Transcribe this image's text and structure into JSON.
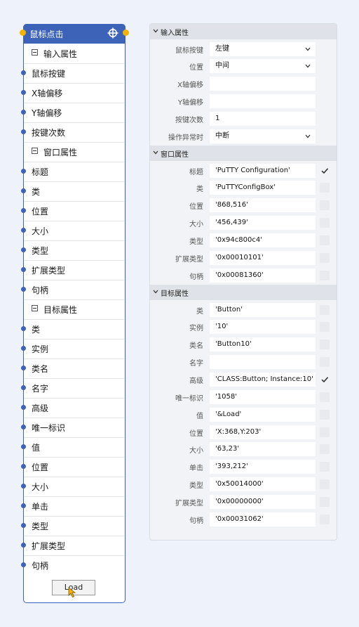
{
  "node": {
    "title": "鼠标点击",
    "load_button": "Load",
    "rows": [
      {
        "type": "group",
        "label": "输入属性"
      },
      {
        "type": "item",
        "label": "鼠标按键"
      },
      {
        "type": "item",
        "label": "X轴偏移"
      },
      {
        "type": "item",
        "label": "Y轴偏移"
      },
      {
        "type": "item",
        "label": "按键次数"
      },
      {
        "type": "group",
        "label": "窗口属性"
      },
      {
        "type": "item",
        "label": "标题"
      },
      {
        "type": "item",
        "label": "类"
      },
      {
        "type": "item",
        "label": "位置"
      },
      {
        "type": "item",
        "label": "大小"
      },
      {
        "type": "item",
        "label": "类型"
      },
      {
        "type": "item",
        "label": "扩展类型"
      },
      {
        "type": "item",
        "label": "句柄"
      },
      {
        "type": "group",
        "label": "目标属性"
      },
      {
        "type": "item",
        "label": "类"
      },
      {
        "type": "item",
        "label": "实例"
      },
      {
        "type": "item",
        "label": "类名"
      },
      {
        "type": "item",
        "label": "名字"
      },
      {
        "type": "item",
        "label": "高级"
      },
      {
        "type": "item",
        "label": "唯一标识"
      },
      {
        "type": "item",
        "label": "值"
      },
      {
        "type": "item",
        "label": "位置"
      },
      {
        "type": "item",
        "label": "大小"
      },
      {
        "type": "item",
        "label": "单击"
      },
      {
        "type": "item",
        "label": "类型"
      },
      {
        "type": "item",
        "label": "扩展类型"
      },
      {
        "type": "item",
        "label": "句柄"
      }
    ]
  },
  "panel": {
    "sections": [
      {
        "title": "输入属性",
        "props": [
          {
            "label": "鼠标按键",
            "value": "左键",
            "dropdown": true
          },
          {
            "label": "位置",
            "value": "中间",
            "dropdown": true
          },
          {
            "label": "X轴偏移",
            "value": ""
          },
          {
            "label": "Y轴偏移",
            "value": ""
          },
          {
            "label": "按键次数",
            "value": "1"
          },
          {
            "label": "操作异常时",
            "value": "中断",
            "dropdown": true
          }
        ]
      },
      {
        "title": "窗口属性",
        "props": [
          {
            "label": "标题",
            "value": "'PuTTY Configuration'",
            "checkbox": true,
            "checked": true
          },
          {
            "label": "类",
            "value": "'PuTTYConfigBox'",
            "checkbox": true,
            "checked": false
          },
          {
            "label": "位置",
            "value": "'868,516'",
            "checkbox": true,
            "checked": false
          },
          {
            "label": "大小",
            "value": "'456,439'",
            "checkbox": true,
            "checked": false
          },
          {
            "label": "类型",
            "value": "'0x94c800c4'",
            "checkbox": true,
            "checked": false
          },
          {
            "label": "扩展类型",
            "value": "'0x00010101'",
            "checkbox": true,
            "checked": false
          },
          {
            "label": "句柄",
            "value": "'0x00081360'",
            "checkbox": true,
            "checked": false
          }
        ]
      },
      {
        "title": "目标属性",
        "props": [
          {
            "label": "类",
            "value": "'Button'",
            "checkbox": true,
            "checked": false
          },
          {
            "label": "实例",
            "value": "'10'",
            "checkbox": true,
            "checked": false
          },
          {
            "label": "类名",
            "value": "'Button10'",
            "checkbox": true,
            "checked": false
          },
          {
            "label": "名字",
            "value": "",
            "checkbox": true,
            "checked": false
          },
          {
            "label": "高级",
            "value": "'CLASS:Button; Instance:10'",
            "checkbox": true,
            "checked": true
          },
          {
            "label": "唯一标识",
            "value": "'1058'",
            "checkbox": true,
            "checked": false
          },
          {
            "label": "值",
            "value": "'&Load'",
            "checkbox": true,
            "checked": false
          },
          {
            "label": "位置",
            "value": "'X:368,Y:203'",
            "checkbox": true,
            "checked": false
          },
          {
            "label": "大小",
            "value": "'63,23'",
            "checkbox": true,
            "checked": false
          },
          {
            "label": "单击",
            "value": "'393,212'",
            "checkbox": true,
            "checked": false
          },
          {
            "label": "类型",
            "value": "'0x50014000'",
            "checkbox": true,
            "checked": false
          },
          {
            "label": "扩展类型",
            "value": "'0x00000000'",
            "checkbox": true,
            "checked": false
          },
          {
            "label": "句柄",
            "value": "'0x00031062'",
            "checkbox": true,
            "checked": false
          }
        ]
      }
    ]
  },
  "colors": {
    "accent": "#3d63b8",
    "port_header": "#f5b400",
    "background": "#eef2fa"
  },
  "icons": [
    "crosshair-icon",
    "minus-box-icon",
    "chevron-down-icon",
    "checkmark-icon",
    "mouse-cursor-icon"
  ]
}
